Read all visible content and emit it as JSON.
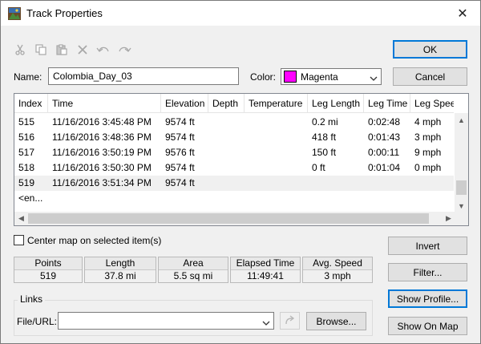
{
  "window": {
    "title": "Track Properties",
    "close_glyph": "✕"
  },
  "toolbar": {
    "icons": [
      "scissors-icon",
      "copy-icon",
      "paste-icon",
      "delete-icon",
      "undo-icon",
      "redo-icon"
    ]
  },
  "buttons": {
    "ok": "OK",
    "cancel": "Cancel",
    "invert": "Invert",
    "filter": "Filter...",
    "show_profile": "Show Profile...",
    "show_on_map": "Show On Map",
    "browse": "Browse..."
  },
  "name_field": {
    "label": "Name:",
    "value": "Colombia_Day_03"
  },
  "color_field": {
    "label": "Color:",
    "value": "Magenta",
    "swatch": "#ff00ff"
  },
  "table": {
    "columns": [
      "Index",
      "Time",
      "Elevation",
      "Depth",
      "Temperature",
      "Leg Length",
      "Leg Time",
      "Leg Speed"
    ],
    "rows": [
      [
        "515",
        "11/16/2016 3:45:48 PM",
        "9574 ft",
        "",
        "",
        "0.2 mi",
        "0:02:48",
        "4 mph"
      ],
      [
        "516",
        "11/16/2016 3:48:36 PM",
        "9574 ft",
        "",
        "",
        "418 ft",
        "0:01:43",
        "3 mph"
      ],
      [
        "517",
        "11/16/2016 3:50:19 PM",
        "9576 ft",
        "",
        "",
        "150 ft",
        "0:00:11",
        "9 mph"
      ],
      [
        "518",
        "11/16/2016 3:50:30 PM",
        "9574 ft",
        "",
        "",
        "0 ft",
        "0:01:04",
        "0 mph"
      ],
      [
        "519",
        "11/16/2016 3:51:34 PM",
        "9574 ft",
        "",
        "",
        "",
        "",
        ""
      ]
    ],
    "end_row": "<en..."
  },
  "center_map": {
    "label": "Center map on selected item(s)",
    "checked": false
  },
  "stats": [
    {
      "header": "Points",
      "value": "519"
    },
    {
      "header": "Length",
      "value": "37.8 mi"
    },
    {
      "header": "Area",
      "value": "5.5 sq mi"
    },
    {
      "header": "Elapsed Time",
      "value": "11:49:41"
    },
    {
      "header": "Avg. Speed",
      "value": "3 mph"
    }
  ],
  "links": {
    "group_label": "Links",
    "file_url_label": "File/URL:",
    "file_url_value": ""
  }
}
